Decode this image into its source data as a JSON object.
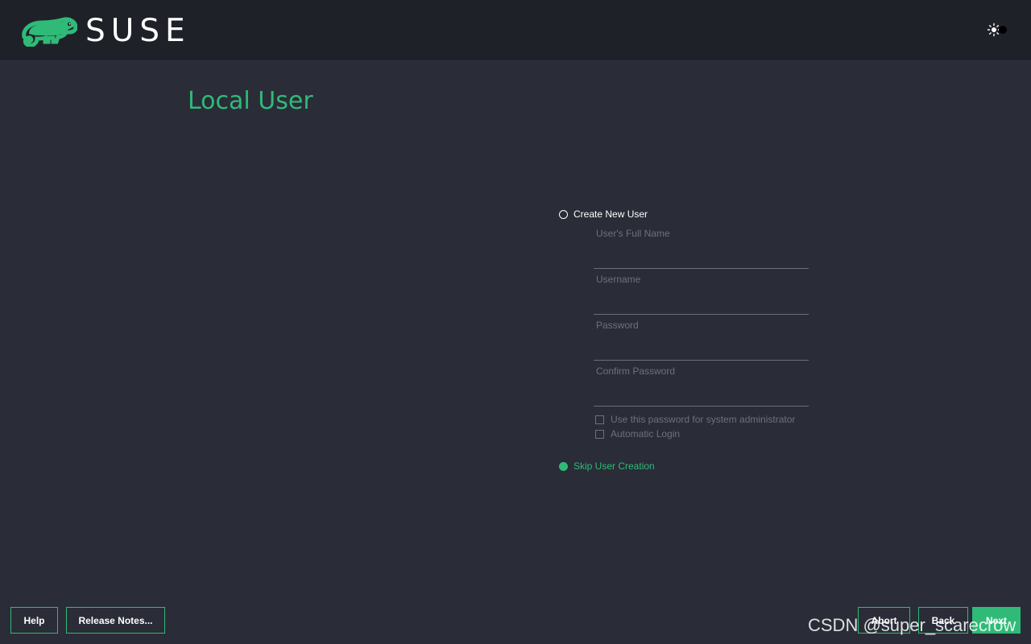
{
  "header": {
    "brand": "SUSE",
    "theme_toggle_icon": "sun-toggle-icon",
    "colors": {
      "background": "#1f2129",
      "brand_green": "#30ba78"
    }
  },
  "page": {
    "title": "Local User",
    "background": "#2a2c37"
  },
  "form": {
    "create_new_user": {
      "label": "Create New User",
      "selected": false
    },
    "fields": [
      {
        "label": "User's Full Name",
        "value": ""
      },
      {
        "label": "Username",
        "value": ""
      },
      {
        "label": "Password",
        "value": ""
      },
      {
        "label": "Confirm Password",
        "value": ""
      }
    ],
    "checkboxes": [
      {
        "label": "Use this password for system administrator",
        "checked": false
      },
      {
        "label": "Automatic Login",
        "checked": false
      }
    ],
    "skip_user_creation": {
      "label": "Skip User Creation",
      "selected": true
    }
  },
  "footer": {
    "help": "Help",
    "release_notes": "Release Notes...",
    "abort": "Abort",
    "back": "Back",
    "next": "Next"
  },
  "watermark": "CSDN @super_scarecrow"
}
